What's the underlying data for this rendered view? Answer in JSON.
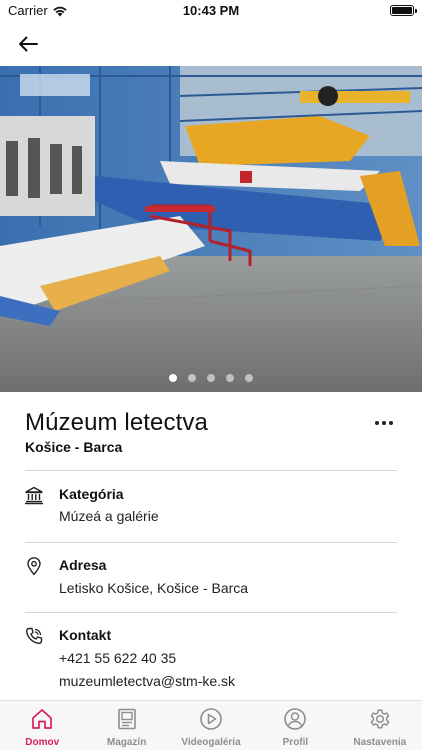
{
  "status_bar": {
    "carrier": "Carrier",
    "time": "10:43 PM"
  },
  "gallery": {
    "dot_count": 5,
    "active_index": 0
  },
  "place": {
    "title": "Múzeum letectva",
    "subtitle": "Košice - Barca"
  },
  "details": {
    "category": {
      "label": "Kategória",
      "value": "Múzeá a galérie",
      "icon": "museum-icon"
    },
    "address": {
      "label": "Adresa",
      "value": "Letisko Košice, Košice - Barca",
      "icon": "location-pin-icon"
    },
    "contact": {
      "label": "Kontakt",
      "phone": "+421 55 622 40 35",
      "email": "muzeumletectva@stm-ke.sk",
      "icon": "phone-icon"
    }
  },
  "tabs": [
    {
      "label": "Domov",
      "icon": "home-icon",
      "active": true
    },
    {
      "label": "Magazín",
      "icon": "magazine-icon",
      "active": false
    },
    {
      "label": "Videogaléria",
      "icon": "play-icon",
      "active": false
    },
    {
      "label": "Profil",
      "icon": "profile-icon",
      "active": false
    },
    {
      "label": "Nastavenia",
      "icon": "settings-icon",
      "active": false
    }
  ],
  "colors": {
    "accent": "#d61f63",
    "tab_inactive": "#8e8e8e",
    "divider": "#d6d6d6"
  }
}
